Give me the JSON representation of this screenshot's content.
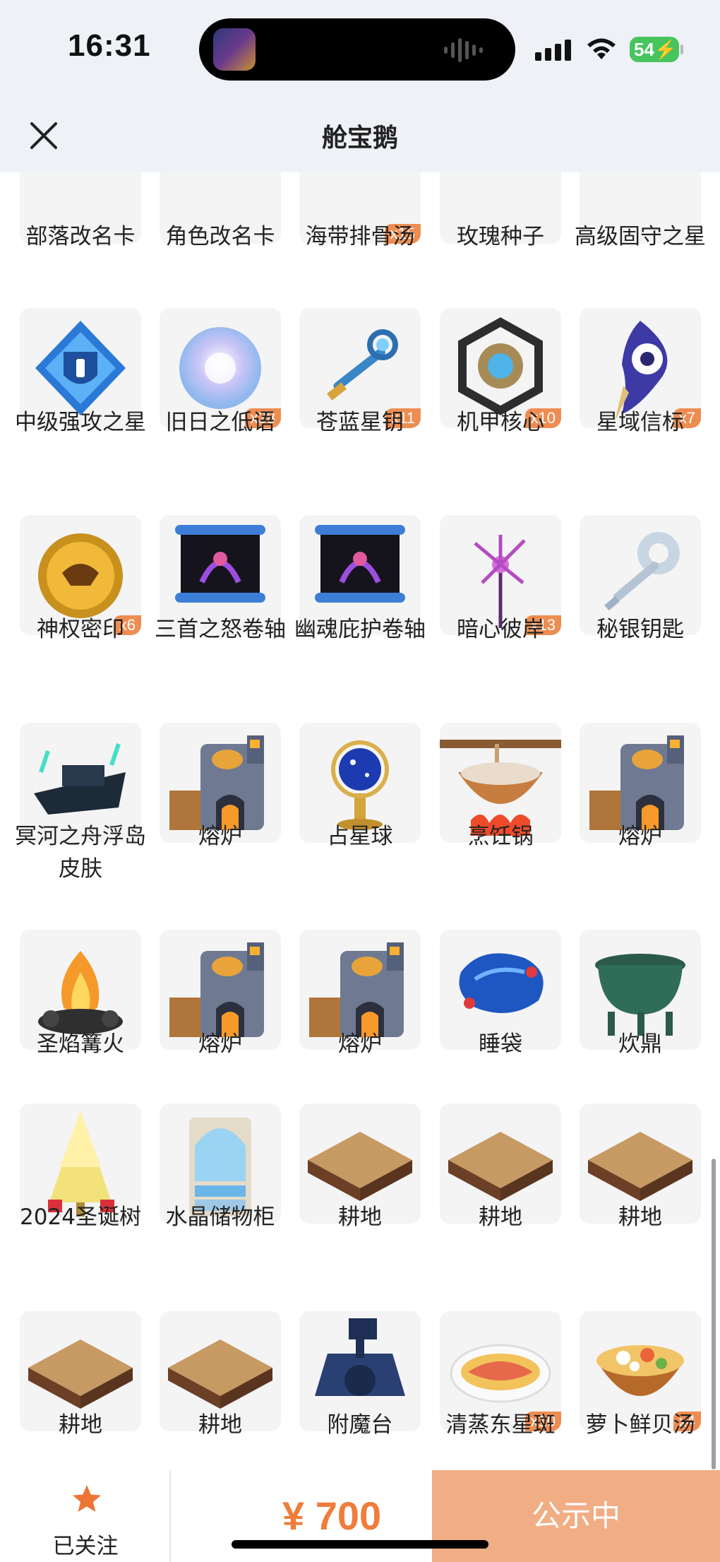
{
  "status_bar": {
    "time": "16:31",
    "battery": "54"
  },
  "header": {
    "title": "舱宝鹅"
  },
  "items": [
    {
      "label": "部落改名卡",
      "qty": "",
      "icon": "rename-card-gold"
    },
    {
      "label": "角色改名卡",
      "qty": "",
      "icon": "rename-card-blue"
    },
    {
      "label": "海带排骨汤",
      "qty": "x15",
      "icon": "soup-pot"
    },
    {
      "label": "玫瑰种子",
      "qty": "",
      "icon": "seed-bag"
    },
    {
      "label": "高级固守之星",
      "qty": "",
      "icon": "purple-crystal"
    },
    {
      "label": "中级强攻之星",
      "qty": "",
      "icon": "blue-diamond-badge"
    },
    {
      "label": "旧日之低语",
      "qty": "x38",
      "icon": "glowing-orb"
    },
    {
      "label": "苍蓝星钥",
      "qty": "x11",
      "icon": "blue-key"
    },
    {
      "label": "机甲核心",
      "qty": "x10",
      "icon": "mech-core"
    },
    {
      "label": "星域信标",
      "qty": "x7",
      "icon": "eye-beacon"
    },
    {
      "label": "神权密印",
      "qty": "x6",
      "icon": "gold-seal"
    },
    {
      "label": "三首之怒卷轴",
      "qty": "",
      "icon": "scroll"
    },
    {
      "label": "幽魂庇护卷轴",
      "qty": "",
      "icon": "scroll"
    },
    {
      "label": "暗心彼岸",
      "qty": "x13",
      "icon": "purple-flower"
    },
    {
      "label": "秘银钥匙",
      "qty": "",
      "icon": "silver-key"
    },
    {
      "label": "冥河之舟浮岛皮肤",
      "qty": "",
      "icon": "dark-ship"
    },
    {
      "label": "熔炉",
      "qty": "",
      "icon": "furnace"
    },
    {
      "label": "占星球",
      "qty": "",
      "icon": "astral-globe"
    },
    {
      "label": "烹饪锅",
      "qty": "",
      "icon": "cooking-pot"
    },
    {
      "label": "熔炉",
      "qty": "",
      "icon": "furnace"
    },
    {
      "label": "圣焰篝火",
      "qty": "",
      "icon": "bonfire"
    },
    {
      "label": "熔炉",
      "qty": "",
      "icon": "furnace"
    },
    {
      "label": "熔炉",
      "qty": "",
      "icon": "furnace"
    },
    {
      "label": "睡袋",
      "qty": "",
      "icon": "sleeping-bag"
    },
    {
      "label": "炊鼎",
      "qty": "",
      "icon": "bronze-cauldron"
    },
    {
      "label": "2024圣诞树",
      "qty": "",
      "icon": "christmas-tree"
    },
    {
      "label": "水晶储物柜",
      "qty": "",
      "icon": "crystal-cabinet"
    },
    {
      "label": "耕地",
      "qty": "",
      "icon": "farmland"
    },
    {
      "label": "耕地",
      "qty": "",
      "icon": "farmland"
    },
    {
      "label": "耕地",
      "qty": "",
      "icon": "farmland"
    },
    {
      "label": "耕地",
      "qty": "",
      "icon": "farmland"
    },
    {
      "label": "耕地",
      "qty": "",
      "icon": "farmland"
    },
    {
      "label": "附魔台",
      "qty": "",
      "icon": "enchant-table"
    },
    {
      "label": "清蒸东星斑",
      "qty": "x10",
      "icon": "steamed-fish"
    },
    {
      "label": "萝卜鲜贝汤",
      "qty": "x4",
      "icon": "soup-bowl"
    }
  ],
  "bottom_bar": {
    "follow_label": "已关注",
    "price": "¥ 700",
    "status_button": "公示中"
  },
  "colors": {
    "accent": "#ef7d3b",
    "button": "#f1ad84",
    "badge": "#ee8d52",
    "header_bg": "#eef1f6"
  }
}
